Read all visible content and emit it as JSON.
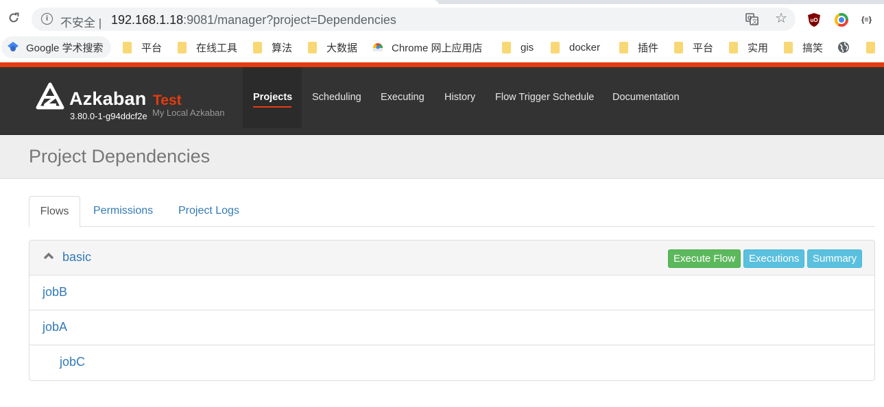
{
  "browser": {
    "insecure_label": "不安全",
    "url_host": "192.168.1.18",
    "url_rest": ":9081/manager?project=Dependencies",
    "bookmarks": [
      {
        "label": "Google 学术搜索",
        "icon": "google-scholar-icon"
      },
      {
        "label": "平台",
        "icon": "folder-icon"
      },
      {
        "label": "在线工具",
        "icon": "folder-icon"
      },
      {
        "label": "算法",
        "icon": "folder-icon"
      },
      {
        "label": "大数据",
        "icon": "folder-icon"
      },
      {
        "label": "Chrome 网上应用店",
        "icon": "chrome-webstore-icon"
      },
      {
        "label": "gis",
        "icon": "folder-icon"
      },
      {
        "label": "docker",
        "icon": "folder-icon"
      },
      {
        "label": "插件",
        "icon": "folder-icon"
      },
      {
        "label": "平台",
        "icon": "folder-icon"
      },
      {
        "label": "实用",
        "icon": "folder-icon"
      },
      {
        "label": "搞笑",
        "icon": "folder-icon"
      }
    ],
    "json_ext_label": "{≡}"
  },
  "navbar": {
    "brand": "Azkaban",
    "env": "Test",
    "version": "3.80.0-1-g94ddcf2e",
    "subtitle": "My Local Azkaban",
    "items": [
      "Projects",
      "Scheduling",
      "Executing",
      "History",
      "Flow Trigger Schedule",
      "Documentation"
    ],
    "active": "Projects",
    "accent_color": "#e63b10"
  },
  "page": {
    "title": "Project Dependencies"
  },
  "tabs": [
    "Flows",
    "Permissions",
    "Project Logs"
  ],
  "flow": {
    "name": "basic",
    "buttons": {
      "execute": "Execute Flow",
      "executions": "Executions",
      "summary": "Summary"
    },
    "jobs": [
      {
        "name": "jobB",
        "level": 0
      },
      {
        "name": "jobA",
        "level": 0
      },
      {
        "name": "jobC",
        "level": 1
      }
    ]
  }
}
